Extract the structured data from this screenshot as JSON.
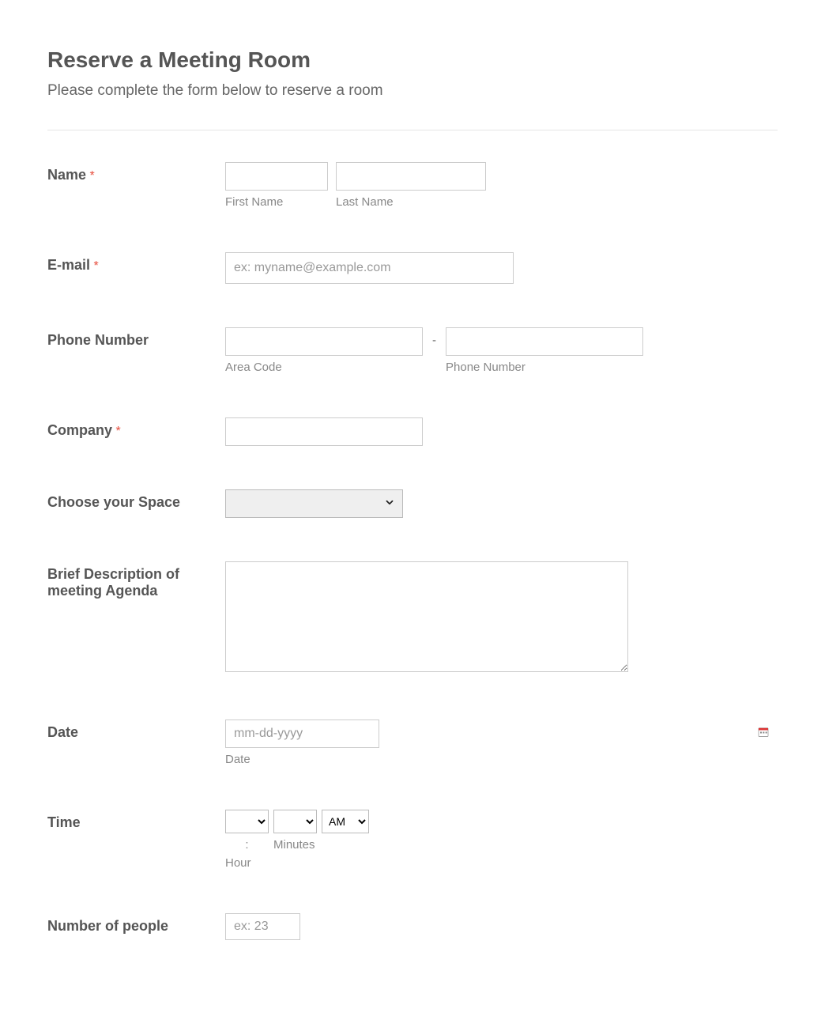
{
  "header": {
    "title": "Reserve a Meeting Room",
    "subtitle": "Please complete the form below to reserve a room"
  },
  "fields": {
    "name": {
      "label": "Name",
      "required": "*",
      "first_sub": "First Name",
      "last_sub": "Last Name"
    },
    "email": {
      "label": "E-mail",
      "required": "*",
      "placeholder": "ex: myname@example.com"
    },
    "phone": {
      "label": "Phone Number",
      "area_sub": "Area Code",
      "number_sub": "Phone Number",
      "dash": "-"
    },
    "company": {
      "label": "Company",
      "required": "*"
    },
    "space": {
      "label": "Choose your Space"
    },
    "agenda": {
      "label": "Brief Description of meeting Agenda"
    },
    "date": {
      "label": "Date",
      "placeholder": "mm-dd-yyyy",
      "sub": "Date"
    },
    "time": {
      "label": "Time",
      "ampm_value": "AM",
      "colon": ":",
      "hour_sub": "Hour",
      "minutes_sub": "Minutes"
    },
    "people": {
      "label": "Number of people",
      "placeholder": "ex: 23"
    }
  }
}
